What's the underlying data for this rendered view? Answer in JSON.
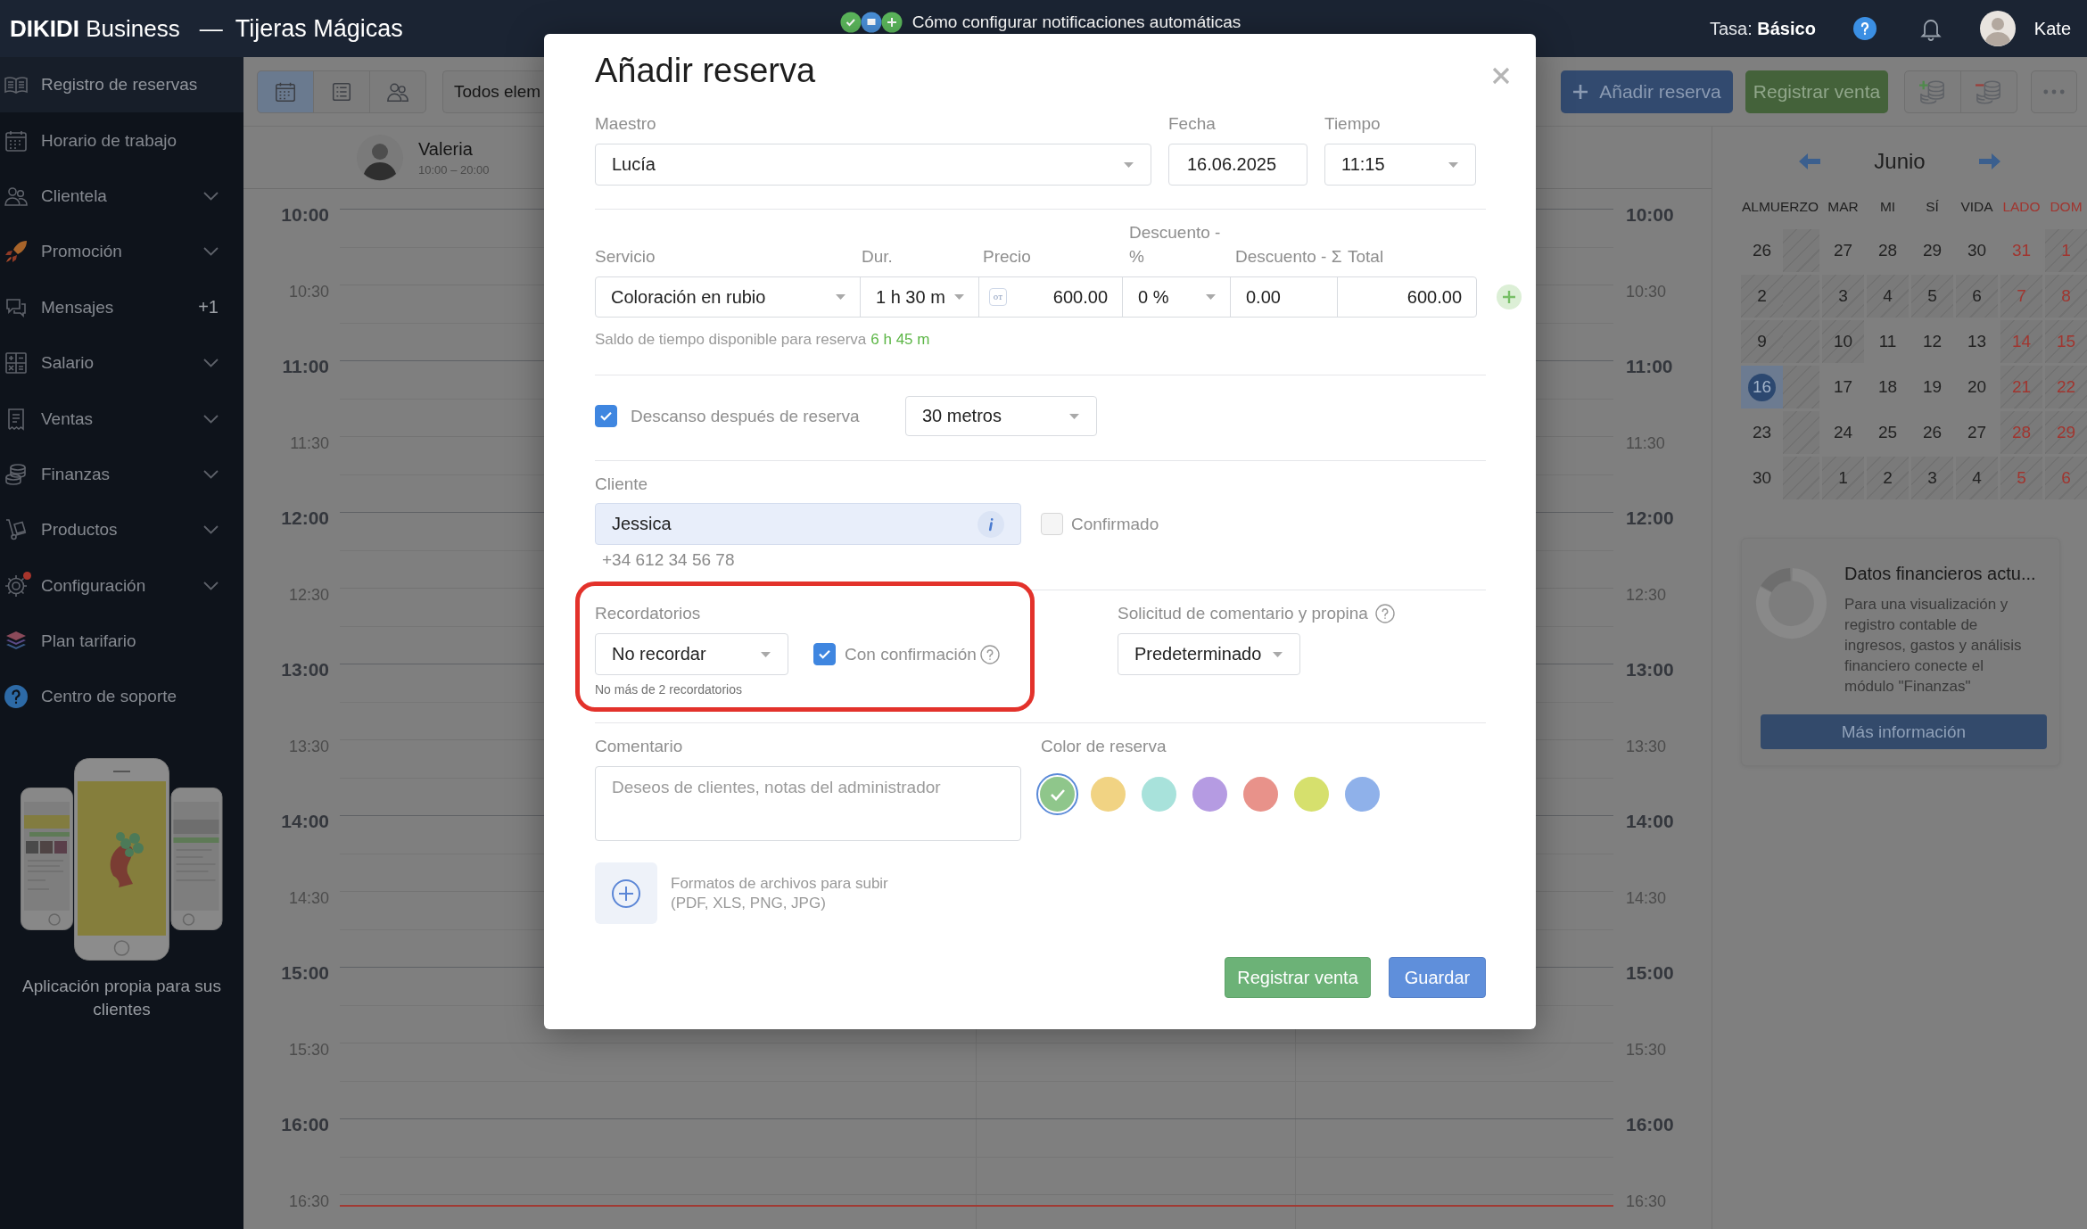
{
  "top_bar": {
    "title": "**DIKIDI** Business",
    "separator": "—",
    "business": "Tijeras Mágicas",
    "banner": "Cómo configurar notificaciones automáticas",
    "plan": "Tasa: **Básico**",
    "user": "Kate"
  },
  "sidebar": {
    "items": [
      {
        "label": "Registro de reservas",
        "selected": true,
        "expandable": false,
        "alert": false
      },
      {
        "label": "Horario de trabajo",
        "selected": false,
        "expandable": false,
        "alert": false
      },
      {
        "label": "Clientela",
        "selected": false,
        "expandable": true,
        "alert": false
      },
      {
        "label": "Promoción",
        "selected": false,
        "expandable": true,
        "alert": false
      },
      {
        "label": "Mensajes",
        "selected": false,
        "expandable": false,
        "alert": false,
        "badge": "+1"
      },
      {
        "label": "Salario",
        "selected": false,
        "expandable": true,
        "alert": false
      },
      {
        "label": "Ventas",
        "selected": false,
        "expandable": true,
        "alert": false
      },
      {
        "label": "Finanzas",
        "selected": false,
        "expandable": true,
        "alert": false
      },
      {
        "label": "Productos",
        "selected": false,
        "expandable": true,
        "alert": false
      },
      {
        "label": "Configuración",
        "selected": false,
        "expandable": true,
        "alert": true
      },
      {
        "label": "Plan tarifario",
        "selected": false,
        "expandable": false,
        "alert": false
      },
      {
        "label": "Centro de soporte",
        "selected": false,
        "expandable": false,
        "alert": false
      }
    ],
    "promo": "Aplicación propia para sus clientes"
  },
  "toolbar": {
    "views": [
      {
        "selected": true
      },
      {
        "selected": false
      },
      {
        "selected": false
      }
    ],
    "filter": "Todos elem",
    "add_button": "Añadir reserva",
    "sale_button": "Registrar venta"
  },
  "schedule": {
    "staff": [
      {
        "name": "Valeria",
        "hours": "10:00 – 20:00"
      }
    ],
    "left_times": [
      {
        "label": "10:00",
        "major": true
      },
      {
        "label": "10:30",
        "major": false
      },
      {
        "label": "11:00",
        "major": true
      },
      {
        "label": "11:30",
        "major": false
      },
      {
        "label": "12:00",
        "major": true
      },
      {
        "label": "12:30",
        "major": false
      },
      {
        "label": "13:00",
        "major": true
      },
      {
        "label": "13:30",
        "major": false
      },
      {
        "label": "14:00",
        "major": true
      },
      {
        "label": "14:30",
        "major": false
      },
      {
        "label": "15:00",
        "major": true
      },
      {
        "label": "15:30",
        "major": false
      },
      {
        "label": "16:00",
        "major": true
      },
      {
        "label": "16:30",
        "major": false
      }
    ],
    "right_times": [
      {
        "label": "10:00",
        "major": true
      },
      {
        "label": "10:30",
        "major": false
      },
      {
        "label": "11:00",
        "major": true
      },
      {
        "label": "11:30",
        "major": false
      },
      {
        "label": "12:00",
        "major": true
      },
      {
        "label": "12:30",
        "major": false
      },
      {
        "label": "13:00",
        "major": true
      },
      {
        "label": "13:30",
        "major": false
      },
      {
        "label": "14:00",
        "major": true
      },
      {
        "label": "14:30",
        "major": false
      },
      {
        "label": "15:00",
        "major": true
      },
      {
        "label": "15:30",
        "major": false
      },
      {
        "label": "16:00",
        "major": true
      },
      {
        "label": "16:30",
        "major": false
      }
    ],
    "current_time_line": true
  },
  "calendar": {
    "month": "Junio",
    "weekdays": [
      {
        "label": "ALMUERZO",
        "weekend": false
      },
      {
        "label": "MAR",
        "weekend": false
      },
      {
        "label": "MI",
        "weekend": false
      },
      {
        "label": "SÍ",
        "weekend": false
      },
      {
        "label": "VIDA",
        "weekend": false
      },
      {
        "label": "LADO",
        "weekend": true
      },
      {
        "label": "DOM",
        "weekend": true
      }
    ],
    "weeks": [
      [
        {
          "day": "26",
          "off": false,
          "selected": false
        },
        {
          "day": "27",
          "off": false,
          "selected": false
        },
        {
          "day": "28",
          "off": false,
          "selected": false
        },
        {
          "day": "29",
          "off": false,
          "selected": false
        },
        {
          "day": "30",
          "off": false,
          "selected": false
        },
        {
          "day": "31",
          "off": false,
          "selected": false
        },
        {
          "day": "1",
          "off": true,
          "selected": false
        }
      ],
      [
        {
          "day": "2",
          "off": true,
          "selected": false
        },
        {
          "day": "3",
          "off": true,
          "selected": false
        },
        {
          "day": "4",
          "off": true,
          "selected": false
        },
        {
          "day": "5",
          "off": true,
          "selected": false
        },
        {
          "day": "6",
          "off": true,
          "selected": false
        },
        {
          "day": "7",
          "off": true,
          "selected": false
        },
        {
          "day": "8",
          "off": true,
          "selected": false
        }
      ],
      [
        {
          "day": "9",
          "off": true,
          "selected": false
        },
        {
          "day": "10",
          "off": true,
          "selected": false
        },
        {
          "day": "11",
          "off": false,
          "selected": false
        },
        {
          "day": "12",
          "off": false,
          "selected": false
        },
        {
          "day": "13",
          "off": false,
          "selected": false
        },
        {
          "day": "14",
          "off": true,
          "selected": false
        },
        {
          "day": "15",
          "off": true,
          "selected": false
        }
      ],
      [
        {
          "day": "16",
          "off": false,
          "selected": true
        },
        {
          "day": "17",
          "off": false,
          "selected": false
        },
        {
          "day": "18",
          "off": false,
          "selected": false
        },
        {
          "day": "19",
          "off": false,
          "selected": false
        },
        {
          "day": "20",
          "off": false,
          "selected": false
        },
        {
          "day": "21",
          "off": true,
          "selected": false
        },
        {
          "day": "22",
          "off": true,
          "selected": false
        }
      ],
      [
        {
          "day": "23",
          "off": false,
          "selected": false
        },
        {
          "day": "24",
          "off": false,
          "selected": false
        },
        {
          "day": "25",
          "off": false,
          "selected": false
        },
        {
          "day": "26",
          "off": false,
          "selected": false
        },
        {
          "day": "27",
          "off": false,
          "selected": false
        },
        {
          "day": "28",
          "off": true,
          "selected": false
        },
        {
          "day": "29",
          "off": true,
          "selected": false
        }
      ],
      [
        {
          "day": "30",
          "off": false,
          "selected": false
        },
        {
          "day": "1",
          "off": true,
          "selected": false
        },
        {
          "day": "2",
          "off": true,
          "selected": false
        },
        {
          "day": "3",
          "off": true,
          "selected": false
        },
        {
          "day": "4",
          "off": true,
          "selected": false
        },
        {
          "day": "5",
          "off": true,
          "selected": false
        },
        {
          "day": "6",
          "off": true,
          "selected": false
        }
      ]
    ]
  },
  "finance_card": {
    "title": "Datos financieros actu...",
    "text": "Para una visualización y registro contable de ingresos, gastos y análisis financiero conecte el módulo \"Finanzas\"",
    "button": "Más información"
  },
  "modal": {
    "title": "Añadir reserva",
    "master": {
      "label": "Maestro",
      "value": "Lucía"
    },
    "date": {
      "label": "Fecha",
      "value": "16.06.2025"
    },
    "time": {
      "label": "Tiempo",
      "value": "11:15"
    },
    "service_columns": [
      "Servicio",
      "Dur.",
      "Precio",
      "Descuento - %",
      "Descuento - Σ",
      "Total"
    ],
    "service": {
      "name": "Coloración en rubio",
      "duration": "1 h 30 m",
      "price_mode": "от",
      "price": "600.00",
      "discount_percent": "0 %",
      "discount_sum": "0.00",
      "total": "600.00"
    },
    "availability": {
      "text": "Saldo de tiempo disponible para reserva",
      "value": "6 h 45 m"
    },
    "break": {
      "label": "Descanso después de reserva",
      "checked": true,
      "duration": "30 metros"
    },
    "client": {
      "label": "Cliente",
      "name": "Jessica",
      "phone": "+34 612 34 56 78",
      "confirmed_label": "Confirmado",
      "confirmed": false
    },
    "reminders": {
      "label": "Recordatorios",
      "value": "No recordar",
      "confirmation_label": "Con confirmación",
      "confirmation": true,
      "note": "No más de 2 recordatorios",
      "highlighted": true
    },
    "feedback": {
      "label": "Solicitud de comentario y propina",
      "value": "Predeterminado"
    },
    "comment": {
      "label": "Comentario",
      "placeholder": "Deseos de clientes, notas del administrador"
    },
    "colors": {
      "label": "Color de reserva",
      "swatches": [
        {
          "color": "#8fc68b",
          "selected": true
        },
        {
          "color": "#f1d383",
          "selected": false
        },
        {
          "color": "#a8e2db",
          "selected": false
        },
        {
          "color": "#b59be2",
          "selected": false
        },
        {
          "color": "#e8928a",
          "selected": false
        },
        {
          "color": "#d6e06d",
          "selected": false
        },
        {
          "color": "#8fb1ea",
          "selected": false
        }
      ]
    },
    "upload": {
      "text": "Formatos de archivos para subir",
      "formats": "(PDF, XLS, PNG, JPG)"
    },
    "buttons": [
      {
        "kind": "sale",
        "label": "Registrar venta"
      },
      {
        "kind": "save",
        "label": "Guardar"
      }
    ]
  }
}
